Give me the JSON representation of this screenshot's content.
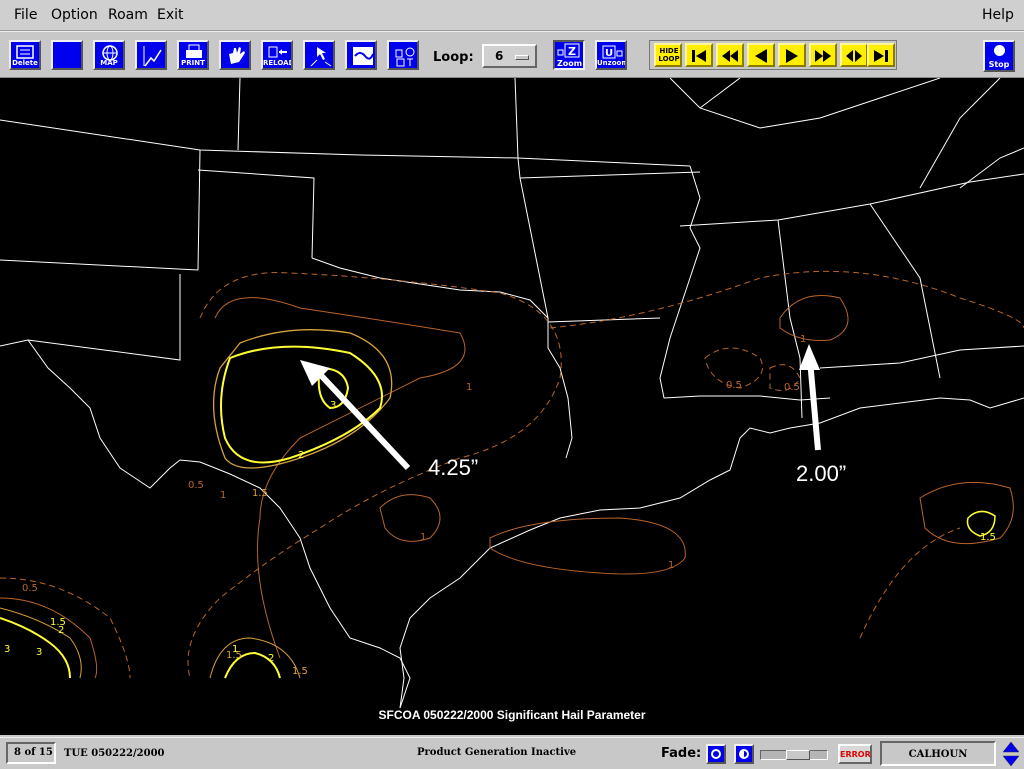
{
  "menubar": {
    "file": "File",
    "option": "Option",
    "roam": "Roam",
    "exit": "Exit",
    "help": "Help"
  },
  "toolbar": {
    "buttons": [
      {
        "icon": "delete-icon",
        "caption": "Delete"
      },
      {
        "icon": "blank-panel-icon",
        "caption": ""
      },
      {
        "icon": "globe-map-icon",
        "caption": "MAP"
      },
      {
        "icon": "lightning-graph-icon",
        "caption": ""
      },
      {
        "icon": "printer-icon",
        "caption": "PRINT"
      },
      {
        "icon": "hand-pan-icon",
        "caption": ""
      },
      {
        "icon": "reload-icon",
        "caption": "RELOAD"
      },
      {
        "icon": "cursor-arrow-icon",
        "caption": ""
      },
      {
        "icon": "satellite-image-icon",
        "caption": ""
      },
      {
        "icon": "text-labels-icon",
        "caption": ""
      }
    ],
    "loop_label": "Loop:",
    "loop_value": "6",
    "zoom_caption": "Zoom",
    "unzoom_caption": "Unzoom",
    "hide_loop_caption": "HIDE LOOP",
    "stop_caption": "Stop"
  },
  "map": {
    "product_title": "SFCOA 050222/2000 Significant Hail Parameter",
    "annotations": [
      {
        "text": "4.25”"
      },
      {
        "text": "2.00”"
      }
    ],
    "contour_labels": [
      "0.5",
      "1",
      "1.5",
      "2",
      "3",
      "0.5",
      "0.5",
      "1",
      "1",
      "1",
      "1",
      "1.5",
      "1.5",
      "2",
      "3",
      "3",
      "1.5",
      "2",
      "1.5",
      "1",
      "0.5"
    ],
    "colors": {
      "background": "#000000",
      "boundaries": "#ffffff",
      "contour_low": "#b8652a",
      "contour_mid": "#d6a23c",
      "contour_high": "#ffff33"
    }
  },
  "status": {
    "frame": "8 of 15",
    "date": "TUE 050222/2000",
    "product_status": "Product Generation Inactive",
    "fade_label": "Fade:",
    "fade_level": 0.6,
    "error_label": "ERROR",
    "site": "CALHOUN"
  }
}
